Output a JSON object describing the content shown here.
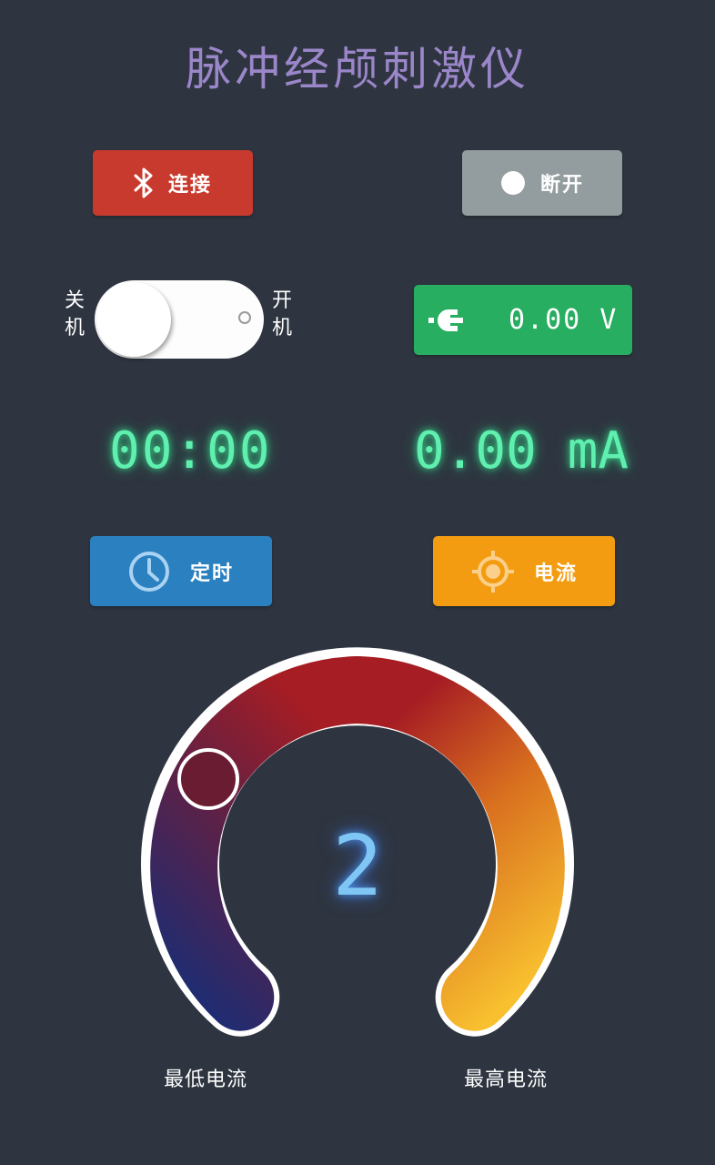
{
  "title": "脉冲经颅刺激仪",
  "buttons": {
    "connect": "连接",
    "disconnect": "断开",
    "timer": "定时",
    "current": "电流"
  },
  "power_toggle": {
    "off_label": "关机",
    "on_label": "开机",
    "state": "off"
  },
  "voltage": {
    "value": "0.00 V"
  },
  "readouts": {
    "time": "00:00",
    "current": "0.00 mA"
  },
  "gauge": {
    "value": "2",
    "min_label": "最低电流",
    "max_label": "最高电流"
  },
  "colors": {
    "connect": "#c93a2e",
    "disconnect": "#939c9f",
    "voltage": "#27ae60",
    "timer": "#2b80c0",
    "current": "#f39c12",
    "background": "#2e3540"
  },
  "icons": {
    "connect": "bluetooth-icon",
    "disconnect": "dot-icon",
    "voltage": "plug-icon",
    "timer": "clock-icon",
    "current": "target-icon"
  }
}
